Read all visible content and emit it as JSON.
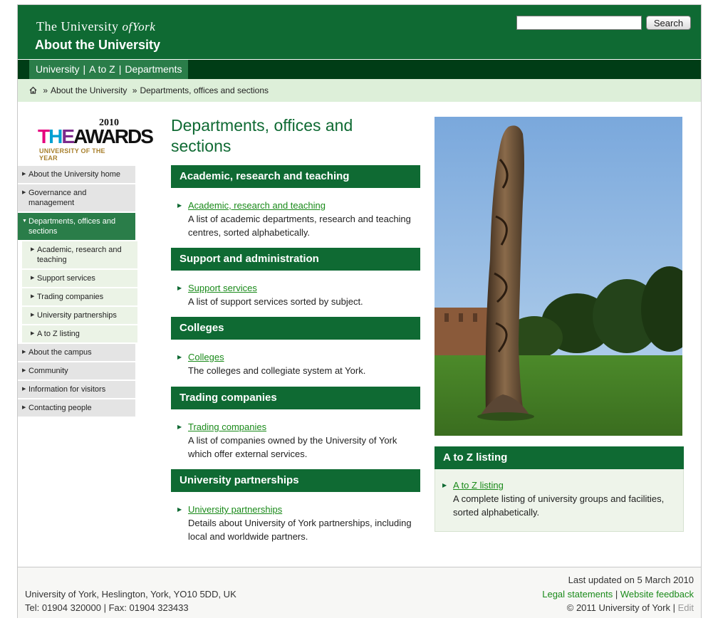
{
  "header": {
    "logo_line_prefix": "The University",
    "logo_line_of": "of",
    "logo_line_suffix": "York",
    "site_title": "About the University",
    "search_placeholder": "",
    "search_button": "Search"
  },
  "topnav": {
    "items": [
      "University",
      "A to Z",
      "Departments"
    ],
    "separator": "|"
  },
  "breadcrumb": {
    "home_icon": "home-icon",
    "sep": "»",
    "items": [
      "About the University",
      "Departments, offices and sections"
    ]
  },
  "awards": {
    "year": "2010",
    "the": [
      "T",
      "H",
      "E"
    ],
    "awards": "AWARDS",
    "subtitle": "UNIVERSITY OF THE YEAR"
  },
  "sidenav": {
    "items": [
      {
        "label": "About the University home"
      },
      {
        "label": "Governance and management"
      },
      {
        "label": "Departments, offices and sections"
      },
      {
        "label": "Academic, research and teaching"
      },
      {
        "label": "Support services"
      },
      {
        "label": "Trading companies"
      },
      {
        "label": "University partnerships"
      },
      {
        "label": "A to Z listing"
      },
      {
        "label": "About the campus"
      },
      {
        "label": "Community"
      },
      {
        "label": "Information for visitors"
      },
      {
        "label": "Contacting people"
      }
    ]
  },
  "main": {
    "title": "Departments, offices and sections",
    "sections": [
      {
        "heading": "Academic, research and teaching",
        "link": "Academic, research and teaching",
        "desc": "A list of academic departments, research and teaching centres, sorted alphabetically."
      },
      {
        "heading": "Support and administration",
        "link": "Support services",
        "desc": "A list of support services sorted by subject."
      },
      {
        "heading": "Colleges",
        "link": "Colleges",
        "desc": "The colleges and collegiate system at York."
      },
      {
        "heading": "Trading companies",
        "link": "Trading companies",
        "desc": "A list of companies owned by the University of York which offer external services."
      },
      {
        "heading": "University partnerships",
        "link": "University partnerships",
        "desc": "Details about University of York partnerships, including local and worldwide partners."
      }
    ]
  },
  "az": {
    "heading": "A to Z listing",
    "link": "A to Z listing",
    "desc": "A complete listing of university groups and facilities, sorted alphabetically."
  },
  "footer": {
    "address": "University of York, Heslington, York, YO10 5DD, UK",
    "tel": "Tel: 01904 320000 | Fax: 01904 323433",
    "updated": "Last updated on 5 March 2010",
    "legal": "Legal statements",
    "link_sep": "|",
    "feedback": "Website feedback",
    "copyright": "© 2011 University of York",
    "edit": "Edit"
  },
  "colors": {
    "brand_green": "#0f6a33",
    "dark_green": "#003d16",
    "breadcrumb_bg": "#ddefd9",
    "link_green": "#1a8a1a"
  }
}
